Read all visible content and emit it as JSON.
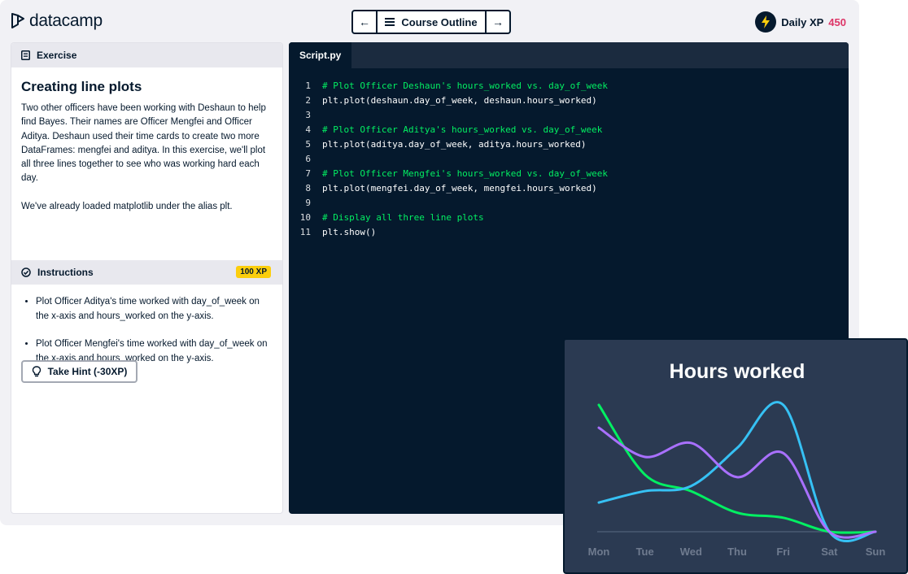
{
  "app": {
    "logo_text": "datacamp",
    "nav": {
      "course_outline_label": "Course Outline"
    },
    "xp": {
      "label": "Daily XP",
      "value": "450"
    }
  },
  "exercise": {
    "section_label": "Exercise",
    "title": "Creating line plots",
    "paragraph1": "Two other officers have been working with Deshaun to help find Bayes. Their names are Officer Mengfei and Officer Aditya. Deshaun used their time cards to create two more DataFrames: mengfei and aditya. In this exercise, we'll plot all three lines together to see who was working hard each day.",
    "paragraph2": "We've already loaded matplotlib under the alias plt."
  },
  "instructions": {
    "section_label": "Instructions",
    "xp_badge": "100 XP",
    "items": [
      "Plot Officer Aditya's time worked with day_of_week on the x-axis and hours_worked on the y-axis.",
      "Plot Officer Mengfei's time worked with day_of_week on the x-axis and hours_worked on the y-axis."
    ],
    "hint_label": "Take Hint (-30XP)"
  },
  "editor": {
    "tab_label": "Script.py",
    "lines": [
      {
        "num": "1",
        "text": "# Plot Officer Deshaun's hours_worked vs. day_of_week",
        "comment": true
      },
      {
        "num": "2",
        "text": "plt.plot(deshaun.day_of_week, deshaun.hours_worked)",
        "comment": false
      },
      {
        "num": "3",
        "text": "",
        "comment": false
      },
      {
        "num": "4",
        "text": "# Plot Officer Aditya's hours_worked vs. day_of_week",
        "comment": true
      },
      {
        "num": "5",
        "text": "plt.plot(aditya.day_of_week, aditya.hours_worked)",
        "comment": false
      },
      {
        "num": "6",
        "text": "",
        "comment": false
      },
      {
        "num": "7",
        "text": "# Plot Officer Mengfei's hours_worked vs. day_of_week",
        "comment": true
      },
      {
        "num": "8",
        "text": "plt.plot(mengfei.day_of_week, mengfei.hours_worked)",
        "comment": false
      },
      {
        "num": "9",
        "text": "",
        "comment": false
      },
      {
        "num": "10",
        "text": "# Display all three line plots",
        "comment": true
      },
      {
        "num": "11",
        "text": "plt.show()",
        "comment": false
      }
    ]
  },
  "chart_data": {
    "type": "line",
    "title": "Hours worked",
    "categories": [
      "Mon",
      "Tue",
      "Wed",
      "Thu",
      "Fri",
      "Sat",
      "Sun"
    ],
    "ylim": [
      0,
      10
    ],
    "grid": false,
    "legend": "none",
    "series": [
      {
        "color": "#03ef62",
        "values": [
          10,
          4.5,
          3.2,
          1.5,
          1.1,
          0,
          0
        ]
      },
      {
        "color": "#36c1f4",
        "values": [
          2.3,
          3.2,
          3.6,
          6.6,
          10,
          0,
          0
        ]
      },
      {
        "color": "#a970ff",
        "values": [
          8.2,
          5.9,
          7.0,
          4.3,
          6.2,
          0,
          0
        ]
      }
    ]
  }
}
